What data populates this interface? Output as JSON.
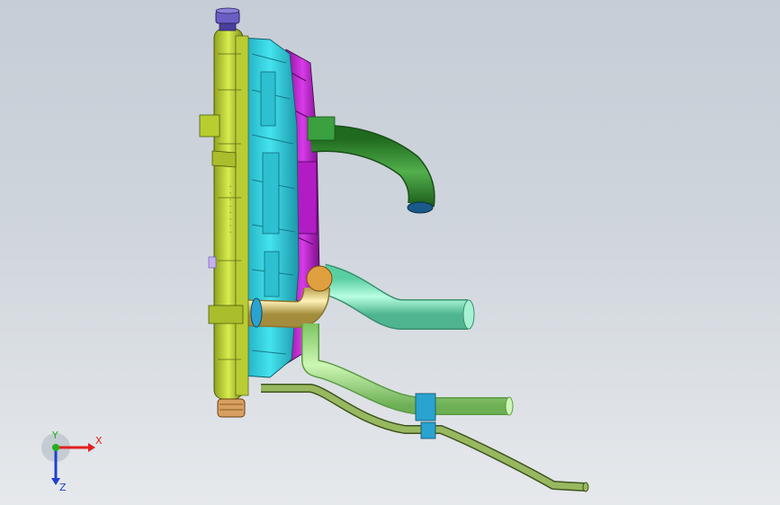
{
  "viewport": {
    "background_top": "#c6cdd6",
    "background_bottom": "#e6e9ec"
  },
  "model": {
    "radiator_tank_color": "#c8dc3a",
    "shroud_color": "#35d3e0",
    "fan_color": "#c229d6",
    "upper_hose_color": "#2f8a2e",
    "lower_hose_color": "#8ff0c8",
    "overflow_hose_color": "#a8e88a",
    "drain_line_color": "#6f8a3c",
    "clamp_color": "#2aa3d0",
    "cap_color": "#5a4fb0",
    "drain_plug_color": "#c8904a",
    "inlet_elbow_color": "#e8d890"
  },
  "triad": {
    "x_label": "X",
    "y_label": "Y",
    "z_label": "Z",
    "x_color": "#e02020",
    "y_color": "#1fb01f",
    "z_color": "#2040d0"
  }
}
